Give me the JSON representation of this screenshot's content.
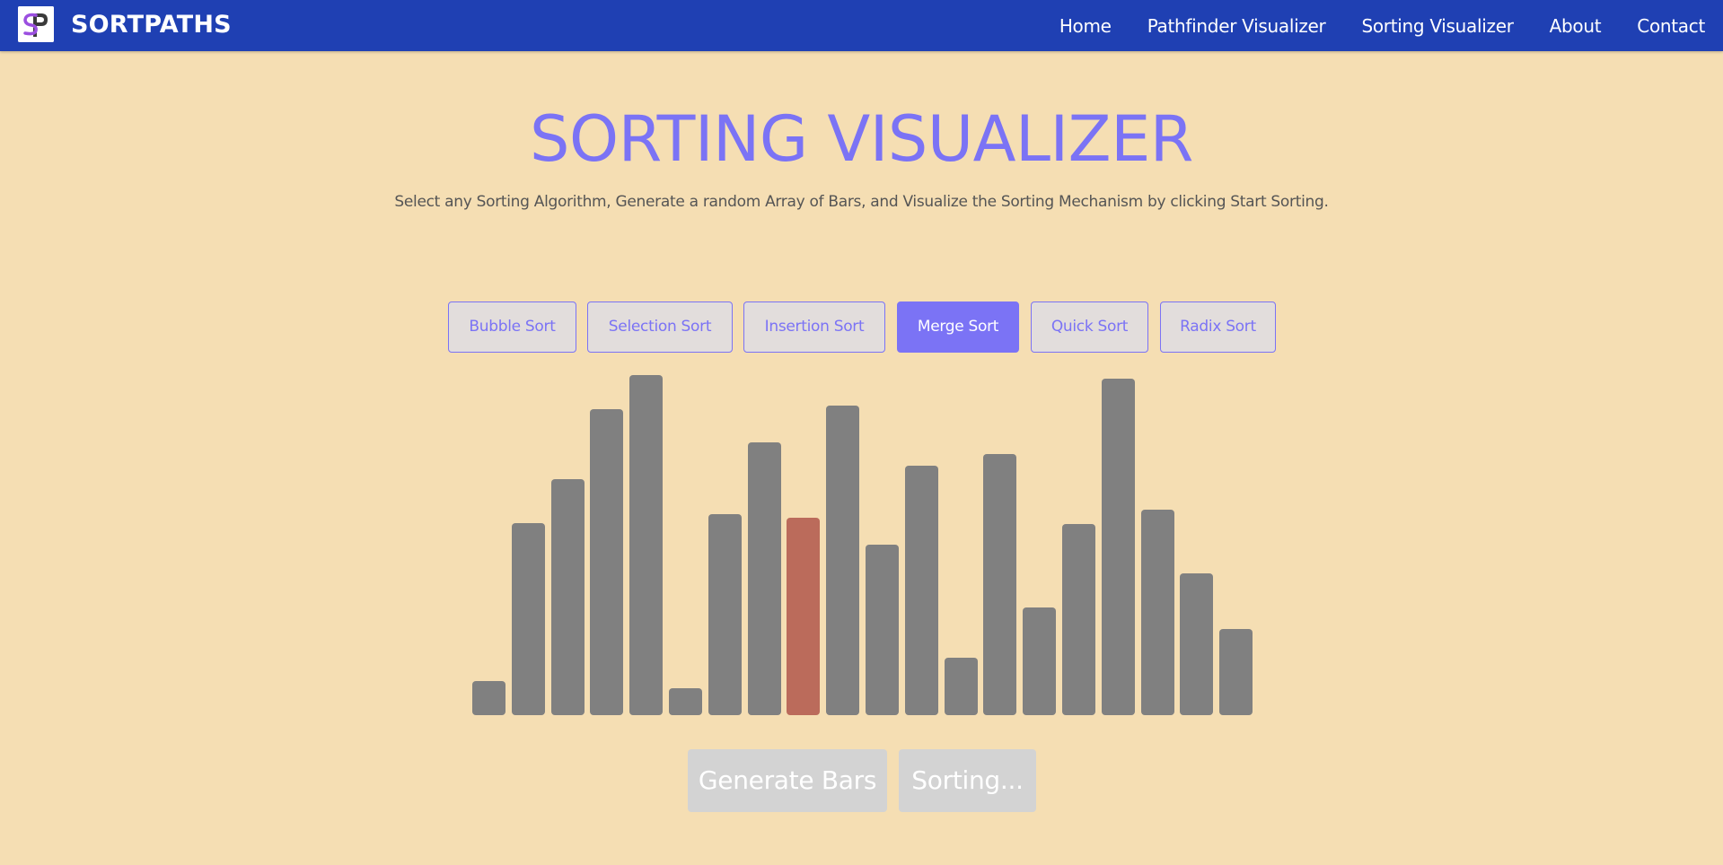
{
  "navbar": {
    "brand": "SORTPATHS",
    "links": [
      {
        "label": "Home"
      },
      {
        "label": "Pathfinder Visualizer"
      },
      {
        "label": "Sorting Visualizer"
      },
      {
        "label": "About"
      },
      {
        "label": "Contact"
      }
    ]
  },
  "header": {
    "title": "SORTING VISUALIZER",
    "subtitle": "Select any Sorting Algorithm, Generate a random Array of Bars, and Visualize the Sorting Mechanism by clicking Start Sorting."
  },
  "algorithms": [
    {
      "label": "Bubble Sort",
      "active": false
    },
    {
      "label": "Selection Sort",
      "active": false
    },
    {
      "label": "Insertion Sort",
      "active": false
    },
    {
      "label": "Merge Sort",
      "active": true
    },
    {
      "label": "Quick Sort",
      "active": false
    },
    {
      "label": "Radix Sort",
      "active": false
    }
  ],
  "bars": {
    "values": [
      38,
      214,
      263,
      341,
      379,
      30,
      224,
      304,
      220,
      345,
      190,
      278,
      64,
      291,
      120,
      213,
      375,
      229,
      158,
      96
    ],
    "highlighted_index": 8,
    "colors": {
      "default": "#808080",
      "highlight": "#bb6b5b"
    }
  },
  "actions": {
    "generate_label": "Generate Bars",
    "sort_label": "Sorting..."
  },
  "colors": {
    "navbar": "#1f40b3",
    "background": "#f5deb3",
    "accent": "#7b73f5",
    "disabled": "#d3d3d3"
  }
}
